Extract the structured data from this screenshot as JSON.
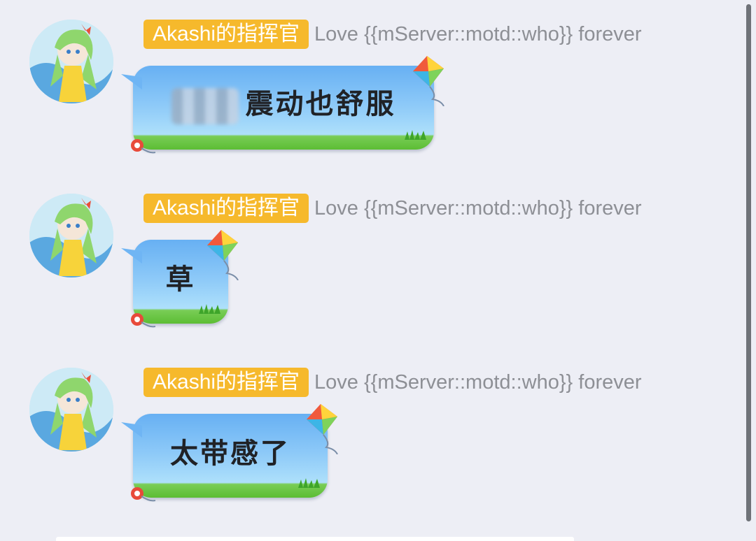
{
  "messages": [
    {
      "sender": "Akashi的指挥官",
      "title": "Love {{mServer::motd::who}} forever",
      "text": "震动也舒服",
      "redacted_prefix": true,
      "avatar": "anime-girl-avatar"
    },
    {
      "sender": "Akashi的指挥官",
      "title": "Love {{mServer::motd::who}} forever",
      "text": "草",
      "redacted_prefix": false,
      "avatar": "anime-girl-avatar"
    },
    {
      "sender": "Akashi的指挥官",
      "title": "Love {{mServer::motd::who}} forever",
      "text": "太带感了",
      "redacted_prefix": false,
      "avatar": "anime-girl-avatar"
    }
  ],
  "colors": {
    "background": "#edeef5",
    "name_tag": "#f6b92c",
    "bubble_top": "#67b0f3",
    "bubble_grass": "#5cbd34",
    "title_text": "#8d8f95"
  },
  "icons": [
    "kite-icon",
    "grass-icon",
    "avatar"
  ]
}
